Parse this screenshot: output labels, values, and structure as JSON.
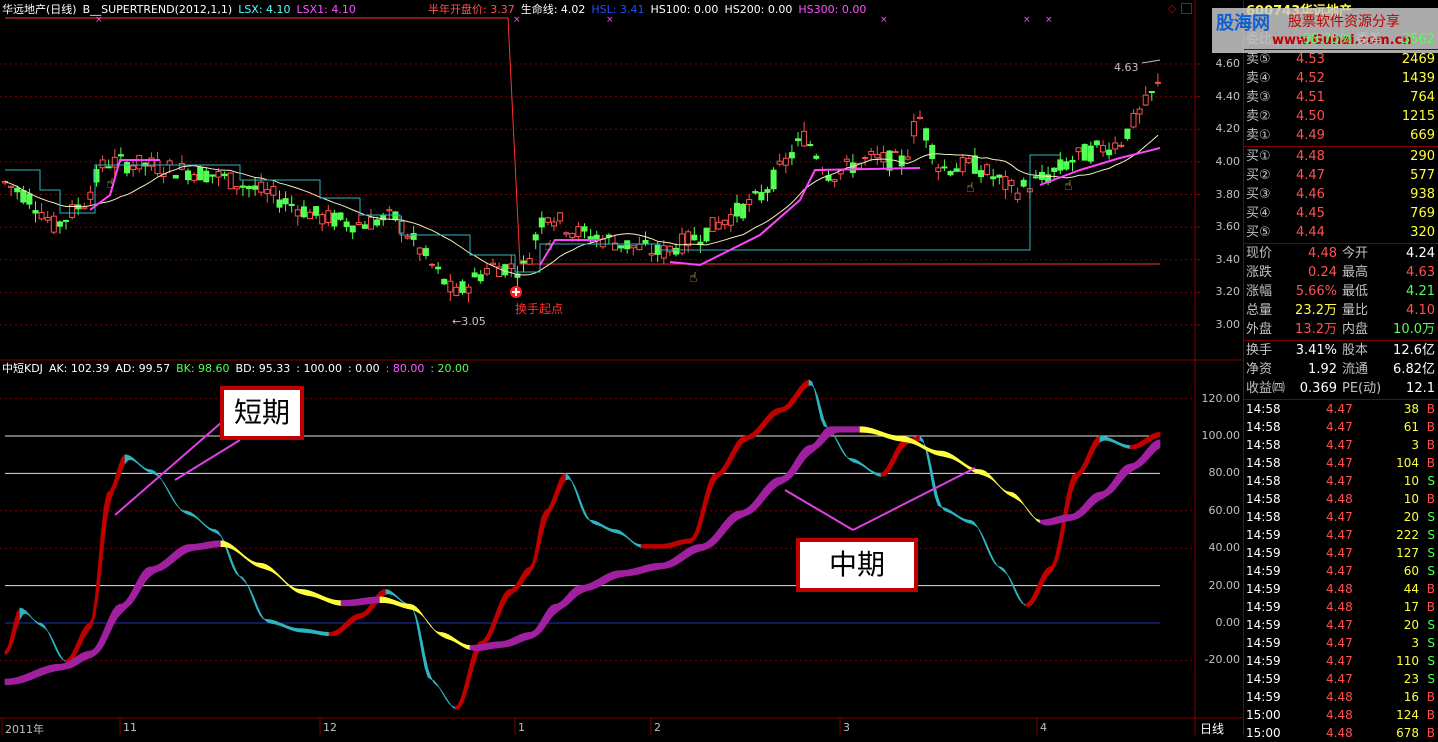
{
  "main_header": {
    "title": "华远地产(日线)",
    "indicator": "B__SUPERTREND(2012,1,1)",
    "lsx": "LSX: 4.10",
    "lsx1": "LSX1: 4.10",
    "half_year_open": "半年开盘价: 3.37",
    "life_line": "生命线: 4.02",
    "hsl": "HSL: 3.41",
    "hs100": "HS100: 0.00",
    "hs200": "HS200: 0.00",
    "hs300": "HS300: 0.00"
  },
  "sub_header": {
    "title": "中短KDJ",
    "ak": "AK: 102.39",
    "ad": "AD: 99.57",
    "bk": "BK: 98.60",
    "bd": "BD: 95.33",
    "c1": ": 100.00",
    "c2": ": 0.00",
    "c3": ": 80.00",
    "c4": ": 20.00"
  },
  "annotations": {
    "short_term": "短期",
    "mid_term": "中期",
    "turnover_start": "换手起点",
    "low_marker": "3.05",
    "high_marker": "4.63"
  },
  "price_axis": [
    "4.60",
    "4.40",
    "4.20",
    "4.00",
    "3.80",
    "3.60",
    "3.40",
    "3.20",
    "3.00"
  ],
  "kdj_axis": [
    "120.00",
    "100.00",
    "80.00",
    "60.00",
    "40.00",
    "20.00",
    "0.00",
    "-20.00"
  ],
  "time_axis": [
    "2011年",
    "11",
    "12",
    "1",
    "2",
    "3",
    "4"
  ],
  "period_button": "日线",
  "watermark": {
    "site": "股海网",
    "slogan": "股票软件资源分享",
    "url": "www.Guhai.com.cn"
  },
  "quote": {
    "code": "600743",
    "name": "华远地产",
    "ratio_label": "委比",
    "ratio": "-38.75%",
    "diff_label": "委差",
    "diff": "-3562",
    "asks": [
      {
        "label": "卖⑤",
        "price": "4.53",
        "vol": "2469"
      },
      {
        "label": "卖④",
        "price": "4.52",
        "vol": "1439"
      },
      {
        "label": "卖③",
        "price": "4.51",
        "vol": "764"
      },
      {
        "label": "卖②",
        "price": "4.50",
        "vol": "1215"
      },
      {
        "label": "卖①",
        "price": "4.49",
        "vol": "669"
      }
    ],
    "bids": [
      {
        "label": "买①",
        "price": "4.48",
        "vol": "290"
      },
      {
        "label": "买②",
        "price": "4.47",
        "vol": "577"
      },
      {
        "label": "买③",
        "price": "4.46",
        "vol": "938"
      },
      {
        "label": "买④",
        "price": "4.45",
        "vol": "769"
      },
      {
        "label": "买⑤",
        "price": "4.44",
        "vol": "320"
      }
    ],
    "stats": [
      {
        "l1": "现价",
        "v1": "4.48",
        "l2": "今开",
        "v2": "4.24"
      },
      {
        "l1": "涨跌",
        "v1": "0.24",
        "l2": "最高",
        "v2": "4.63"
      },
      {
        "l1": "涨幅",
        "v1": "5.66%",
        "l2": "最低",
        "v2": "4.21"
      },
      {
        "l1": "总量",
        "v1": "23.2万",
        "l2": "量比",
        "v2": "4.10"
      },
      {
        "l1": "外盘",
        "v1": "13.2万",
        "l2": "内盘",
        "v2": "10.0万"
      }
    ],
    "fund": [
      {
        "l1": "换手",
        "v1": "3.41%",
        "l2": "股本",
        "v2": "12.6亿"
      },
      {
        "l1": "净资",
        "v1": "1.92",
        "l2": "流通",
        "v2": "6.82亿"
      },
      {
        "l1": "收益㈣",
        "v1": "0.369",
        "l2": "PE(动)",
        "v2": "12.1"
      }
    ],
    "ticks": [
      {
        "t": "14:58",
        "p": "4.47",
        "v": "38",
        "s": "B"
      },
      {
        "t": "14:58",
        "p": "4.47",
        "v": "61",
        "s": "B"
      },
      {
        "t": "14:58",
        "p": "4.47",
        "v": "3",
        "s": "B"
      },
      {
        "t": "14:58",
        "p": "4.47",
        "v": "104",
        "s": "B"
      },
      {
        "t": "14:58",
        "p": "4.47",
        "v": "10",
        "s": "S"
      },
      {
        "t": "14:58",
        "p": "4.48",
        "v": "10",
        "s": "B"
      },
      {
        "t": "14:58",
        "p": "4.47",
        "v": "20",
        "s": "S"
      },
      {
        "t": "14:59",
        "p": "4.47",
        "v": "222",
        "s": "S"
      },
      {
        "t": "14:59",
        "p": "4.47",
        "v": "127",
        "s": "S"
      },
      {
        "t": "14:59",
        "p": "4.47",
        "v": "60",
        "s": "S"
      },
      {
        "t": "14:59",
        "p": "4.48",
        "v": "44",
        "s": "B"
      },
      {
        "t": "14:59",
        "p": "4.48",
        "v": "17",
        "s": "B"
      },
      {
        "t": "14:59",
        "p": "4.47",
        "v": "20",
        "s": "S"
      },
      {
        "t": "14:59",
        "p": "4.47",
        "v": "3",
        "s": "S"
      },
      {
        "t": "14:59",
        "p": "4.47",
        "v": "110",
        "s": "S"
      },
      {
        "t": "14:59",
        "p": "4.47",
        "v": "23",
        "s": "S"
      },
      {
        "t": "14:59",
        "p": "4.48",
        "v": "16",
        "s": "B"
      },
      {
        "t": "15:00",
        "p": "4.48",
        "v": "124",
        "s": "B"
      },
      {
        "t": "15:00",
        "p": "4.48",
        "v": "678",
        "s": "B"
      }
    ]
  },
  "colors": {
    "up": "#ff5050",
    "down": "#54ff54",
    "grid": "#800000",
    "magenta": "#ff44ff",
    "cyan": "#2fb5c0",
    "yellow": "#ffff40",
    "darkred": "#c00000",
    "purple": "#a020a0"
  }
}
